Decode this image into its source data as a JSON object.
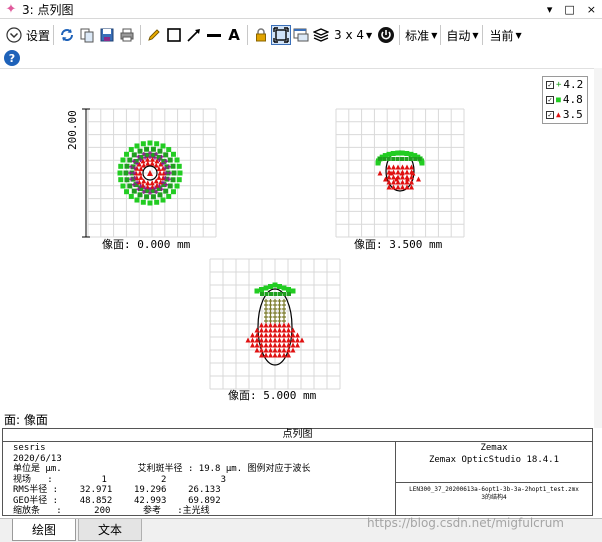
{
  "window": {
    "title": "3: 点列图",
    "controls": [
      "▾",
      "□",
      "×"
    ]
  },
  "toolbar": {
    "settings_label": "设置",
    "layout_label": "3 x 4",
    "standard_label": "标准",
    "auto_label": "自动",
    "current_label": "当前"
  },
  "legend": {
    "items": [
      {
        "label": "4.2",
        "color": "#1f9f1f",
        "marker": "+"
      },
      {
        "label": "4.8",
        "color": "#22cc22",
        "marker": "■"
      },
      {
        "label": "3.5",
        "color": "#e01010",
        "marker": "▲"
      }
    ]
  },
  "plot": {
    "scale_label": "200.00",
    "surfaces": [
      {
        "label": "像面: 0.000 mm"
      },
      {
        "label": "像面: 3.500 mm"
      },
      {
        "label": "像面: 5.000 mm"
      }
    ],
    "face_label": "面: 像面"
  },
  "info": {
    "header": "点列图",
    "lines": [
      "sesris",
      "2020/6/13",
      "单位是 μm.              艾利斑半径 : 19.8 μm. 图例对应于波长",
      "视场   :         1          2          3",
      "RMS半径 :    32.971    19.296    26.133",
      "GEO半径 :    48.852    42.993    69.892",
      "缩放条   :      200      参考   :主光线"
    ],
    "company": "Zemax",
    "product": "Zemax OpticStudio 18.4.1",
    "file_name": "LEN300_37_20200613a-6opt1-3b-3a-2hopt1_test.zmx",
    "config": "3的结构4"
  },
  "tabs": [
    {
      "label": "绘图",
      "active": true
    },
    {
      "label": "文本",
      "active": false
    }
  ],
  "watermark": "https://blog.csdn.net/migfulcrum",
  "colors": {
    "ray_green_dark": "#1f9f1f",
    "ray_green": "#22cc22",
    "ray_red": "#e01010",
    "grid": "#d9d9d9",
    "accent_blue": "#1e62b9"
  }
}
